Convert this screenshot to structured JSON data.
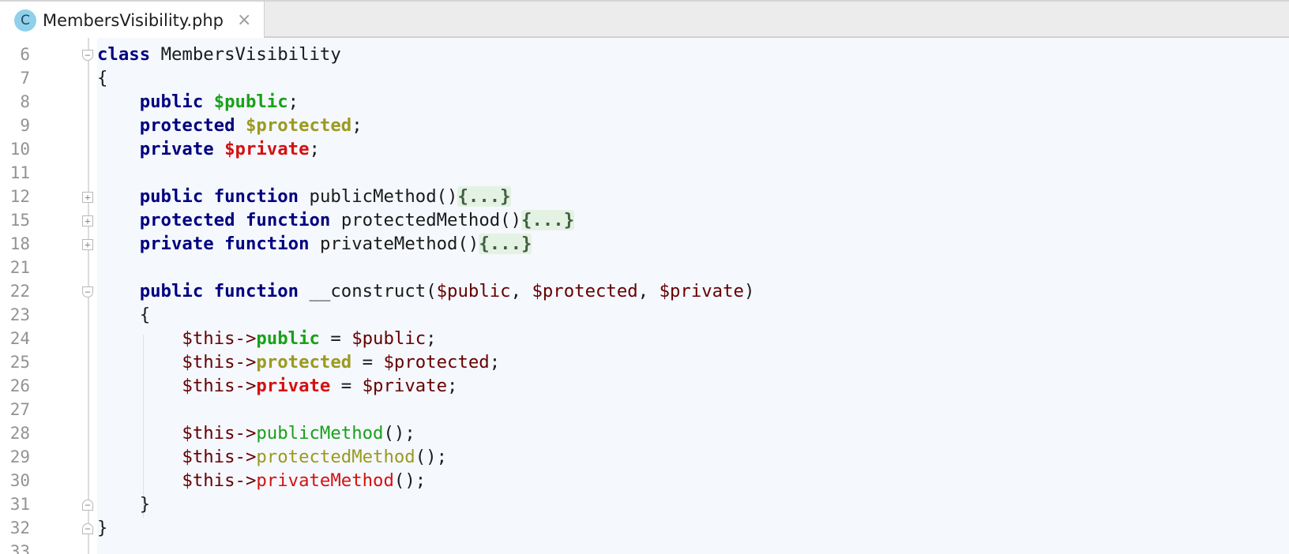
{
  "tab": {
    "icon_letter": "C",
    "filename": "MembersVisibility.php",
    "close_glyph": "×"
  },
  "editor": {
    "line_numbers": [
      "6",
      "7",
      "8",
      "9",
      "10",
      "11",
      "12",
      "15",
      "18",
      "21",
      "22",
      "23",
      "24",
      "25",
      "26",
      "27",
      "28",
      "29",
      "30",
      "31",
      "32",
      "33"
    ],
    "tokens": {
      "class_kw": "class",
      "class_name": "MembersVisibility",
      "open_brace": "{",
      "close_brace": "}",
      "public_kw": "public",
      "protected_kw": "protected",
      "private_kw": "private",
      "function_kw": "function",
      "prop_public": "$public",
      "prop_protected": "$protected",
      "prop_private": "$private",
      "semicolon": ";",
      "m_public": "publicMethod()",
      "m_protected": "protectedMethod()",
      "m_private": "privateMethod()",
      "folded": "{...}",
      "ctor_name": "__construct(",
      "comma": ", ",
      "close_paren": ")",
      "this_arrow": "$this->",
      "assign": " = ",
      "call_public": "publicMethod",
      "call_protected": "protectedMethod",
      "call_private": "privateMethod",
      "call_suffix": "();"
    }
  },
  "colors": {
    "keyword": "#000080",
    "public_member": "#19a119",
    "protected_member": "#9b9a1f",
    "private_member": "#d41111",
    "variable": "#660000",
    "editor_bg": "#f5f8fd"
  }
}
